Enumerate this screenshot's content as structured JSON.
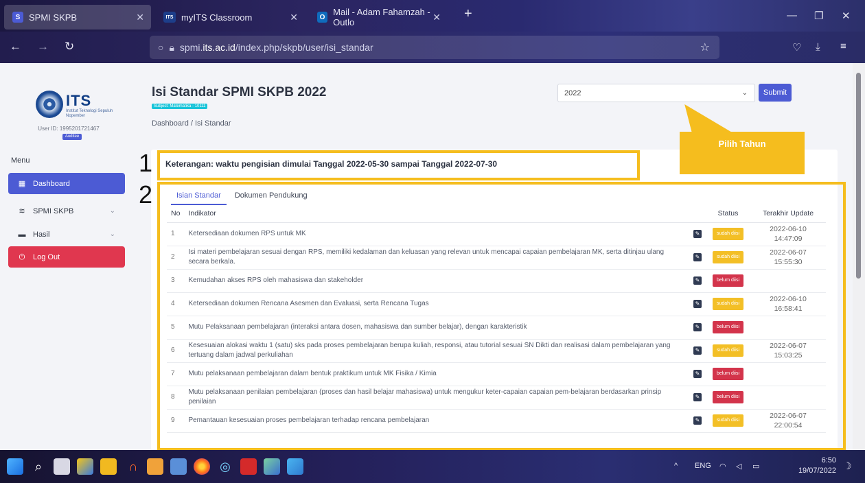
{
  "browser": {
    "tabs": [
      {
        "label": "SPMI SKPB",
        "favicon": "S"
      },
      {
        "label": "myITS Classroom",
        "favicon": "ITS"
      },
      {
        "label": "Mail - Adam Fahamzah - Outlo",
        "favicon": "O"
      }
    ],
    "url_prefix": "spmi.",
    "url_domain": "its.ac.id",
    "url_path": "/index.php/skpb/user/isi_standar"
  },
  "sidebar": {
    "logo_text": "ITS",
    "logo_sub": "Institut Teknologi Sepuluh Nopember",
    "user_id": "User ID: 1995201721467",
    "role": "Auditee",
    "menu_title": "Menu",
    "items": [
      {
        "label": "Dashboard"
      },
      {
        "label": "SPMI SKPB"
      },
      {
        "label": "Hasil"
      },
      {
        "label": "Log Out"
      }
    ]
  },
  "page": {
    "title": "Isi Standar SPMI SKPB 2022",
    "subject": "Subject: Matematika - 10111",
    "breadcrumb": "Dashboard / Isi Standar",
    "year_value": "2022",
    "submit_label": "Submit",
    "callout": "Pilih Tahun",
    "marker1": "1",
    "marker2": "2",
    "keterangan": "Keterangan: waktu pengisian dimulai Tanggal 2022-05-30 sampai Tanggal 2022-07-30",
    "tabs": [
      {
        "label": "Isian Standar"
      },
      {
        "label": "Dokumen Pendukung"
      }
    ]
  },
  "table": {
    "headers": {
      "no": "No",
      "indikator": "Indikator",
      "status": "Status",
      "update": "Terakhir Update"
    },
    "rows": [
      {
        "no": "1",
        "indikator": "Ketersediaan dokumen RPS untuk MK",
        "status": "sudah diisi",
        "date": "2022-06-10",
        "time": "14:47:09"
      },
      {
        "no": "2",
        "indikator": "Isi materi pembelajaran sesuai dengan RPS, memiliki kedalaman dan keluasan yang relevan untuk mencapai capaian pembelajaran MK, serta ditinjau ulang secara berkala.",
        "status": "sudah diisi",
        "date": "2022-06-07",
        "time": "15:55:30"
      },
      {
        "no": "3",
        "indikator": "Kemudahan akses RPS oleh mahasiswa dan stakeholder",
        "status": "belum diisi",
        "date": "",
        "time": ""
      },
      {
        "no": "4",
        "indikator": "Ketersediaan dokumen Rencana Asesmen dan Evaluasi, serta Rencana Tugas",
        "status": "sudah diisi",
        "date": "2022-06-10",
        "time": "16:58:41"
      },
      {
        "no": "5",
        "indikator": "Mutu Pelaksanaan pembelajaran (interaksi antara dosen, mahasiswa dan sumber belajar), dengan karakteristik",
        "status": "belum diisi",
        "date": "",
        "time": ""
      },
      {
        "no": "6",
        "indikator": "Kesesuaian alokasi waktu 1 (satu) sks pada proses pembelajaran berupa kuliah, responsi, atau tutorial sesuai SN Dikti dan realisasi dalam pembelajaran yang tertuang dalam jadwal perkuliahan",
        "status": "sudah diisi",
        "date": "2022-06-07",
        "time": "15:03:25"
      },
      {
        "no": "7",
        "indikator": "Mutu pelaksanaan pembelajaran dalam bentuk praktikum untuk MK Fisika / Kimia",
        "status": "belum diisi",
        "date": "",
        "time": ""
      },
      {
        "no": "8",
        "indikator": "Mutu pelaksanaan penilaian pembelajaran (proses dan hasil belajar mahasiswa) untuk mengukur keter-capaian capaian pem-belajaran berdasarkan prinsip penilaian",
        "status": "belum diisi",
        "date": "",
        "time": ""
      },
      {
        "no": "9",
        "indikator": "Pemantauan kesesuaian proses pembelajaran terhadap rencana pembelajaran",
        "status": "sudah diisi",
        "date": "2022-06-07",
        "time": "22:00:54"
      }
    ]
  },
  "taskbar": {
    "lang": "ENG",
    "time": "6:50",
    "date": "19/07/2022"
  }
}
